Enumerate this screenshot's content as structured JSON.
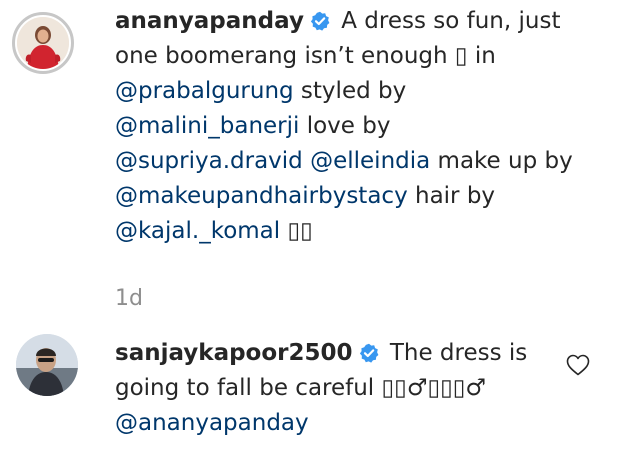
{
  "post": {
    "username": "ananyapanday",
    "caption": {
      "t1": " A dress so fun, just one boomerang isn’t enough ▯ in ",
      "m1": "@prabalgurung",
      "t2": " styled by ",
      "m2": "@malini_banerji",
      "t3": " love by ",
      "m3": "@supriya.dravid",
      "t4": " ",
      "m4": "@elleindia",
      "t5": " make up by ",
      "m5": "@makeupandhairbystacy",
      "t6": " hair by ",
      "m6": "@kajal._komal",
      "t7": " ▯▯"
    },
    "time": "1d"
  },
  "comment": {
    "username": "sanjaykapoor2500",
    "t1": " The dress is going to fall be careful ▯▯♂▯▯▯♂ ",
    "m1": "@ananyapanday"
  },
  "colors": {
    "verified": "#3897f0",
    "mention": "#00376b",
    "muted": "#8e8e8e"
  },
  "icons": {
    "verified": "verified-badge-icon",
    "like": "heart-outline-icon"
  }
}
